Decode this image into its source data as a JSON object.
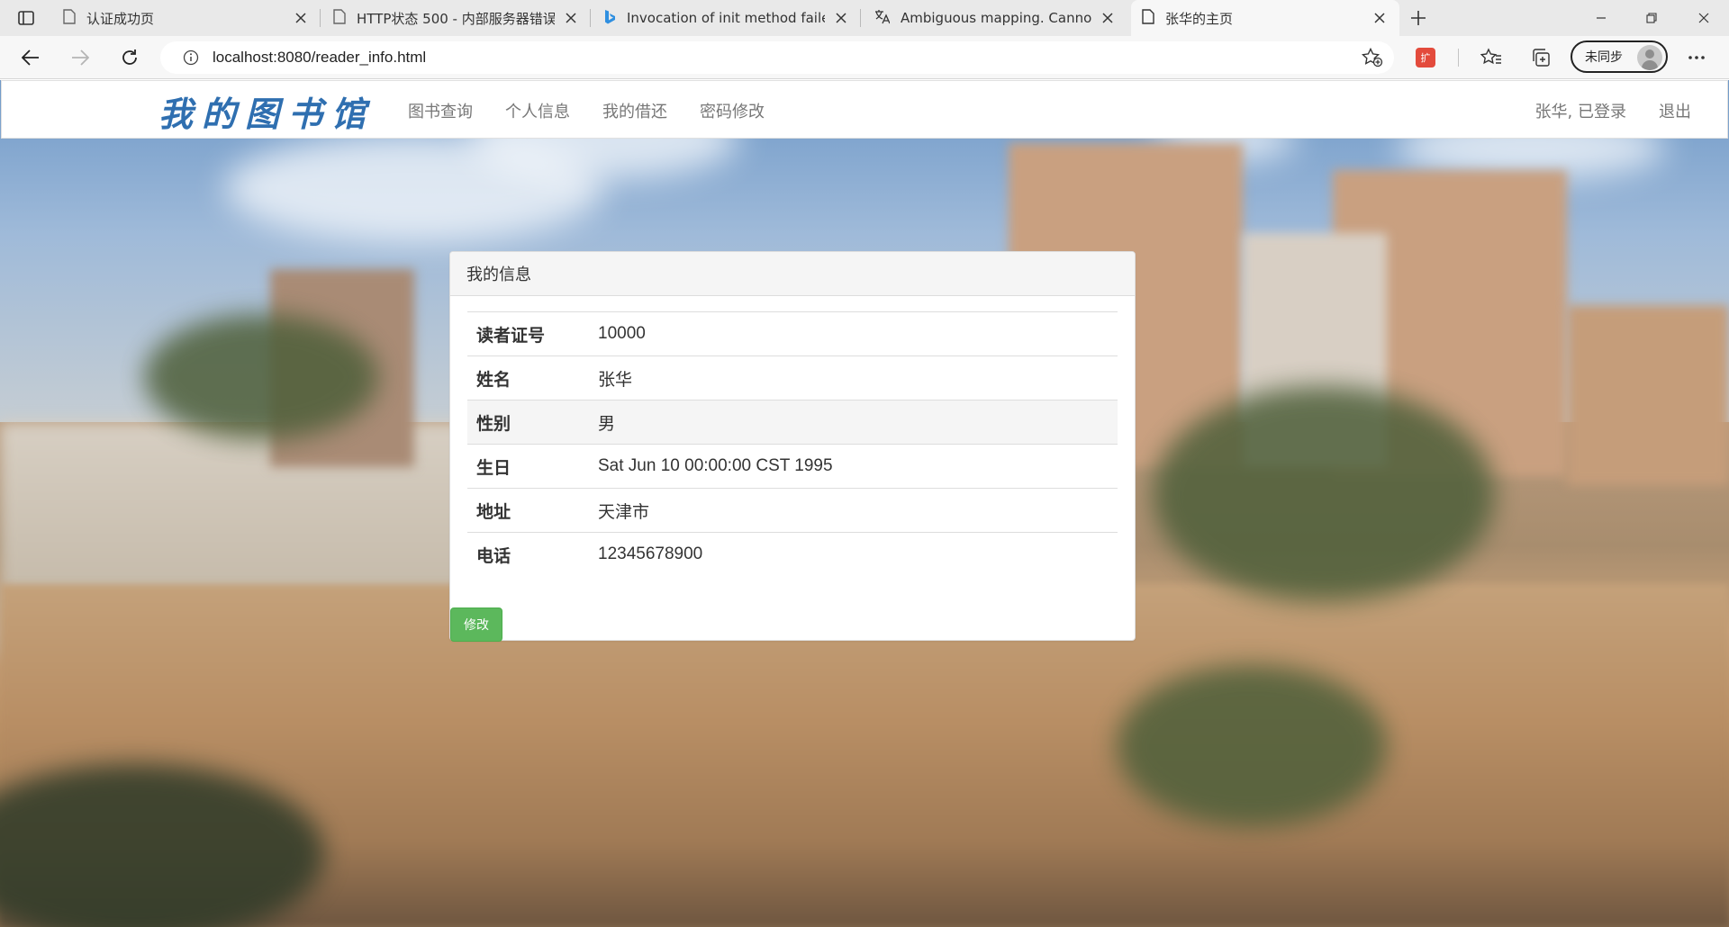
{
  "browser": {
    "tabs": [
      {
        "title": "认证成功页",
        "icon": "page-icon",
        "active": false
      },
      {
        "title": "HTTP状态 500 - 内部服务器错误",
        "icon": "page-icon",
        "active": false
      },
      {
        "title": "Invocation of init method failed;",
        "icon": "bing-icon",
        "active": false
      },
      {
        "title": "Ambiguous mapping. Cannot ma",
        "icon": "translate-icon",
        "active": false
      },
      {
        "title": "张华的主页",
        "icon": "page-icon",
        "active": true
      }
    ],
    "url": "localhost:8080/reader_info.html",
    "profile_label": "未同步",
    "extension_label": "扩"
  },
  "navbar": {
    "brand": "我的图书馆",
    "links": [
      "图书查询",
      "个人信息",
      "我的借还",
      "密码修改"
    ],
    "user_status": "张华, 已登录",
    "logout": "退出"
  },
  "panel": {
    "title": "我的信息",
    "rows": [
      {
        "label": "读者证号",
        "value": "10000"
      },
      {
        "label": "姓名",
        "value": "张华"
      },
      {
        "label": "性别",
        "value": "男"
      },
      {
        "label": "生日",
        "value": "Sat Jun 10 00:00:00 CST 1995"
      },
      {
        "label": "地址",
        "value": "天津市"
      },
      {
        "label": "电话",
        "value": "12345678900"
      }
    ],
    "edit_button": "修改"
  },
  "colors": {
    "brand": "#2f6fb0",
    "success_button": "#5cb85c",
    "nav_text": "#777777"
  }
}
